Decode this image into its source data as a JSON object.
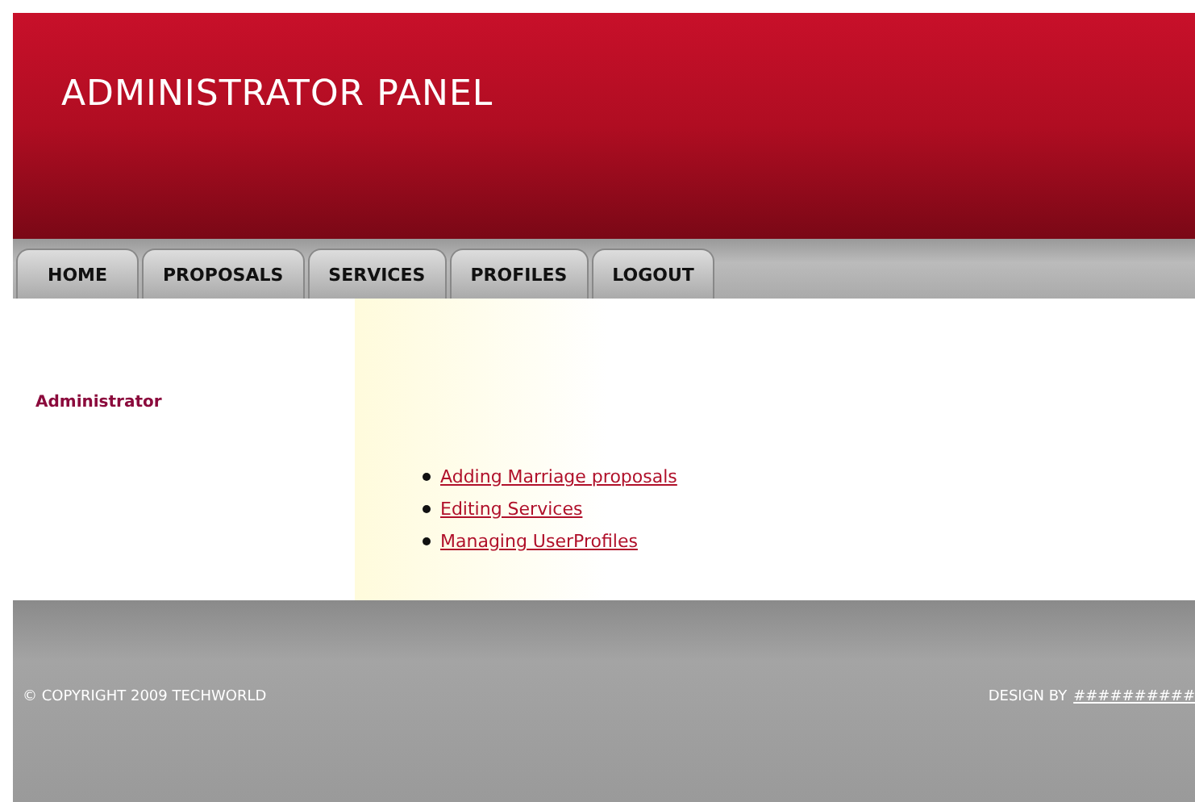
{
  "header": {
    "title": "ADMINISTRATOR PANEL"
  },
  "nav": {
    "tabs": [
      "HOME",
      "PROPOSALS",
      "SERVICES",
      "PROFILES",
      "LOGOUT"
    ]
  },
  "sidebar": {
    "heading": "Administrator"
  },
  "links": [
    "Adding Marriage proposals",
    "Editing Services",
    "Managing UserProfiles"
  ],
  "footer": {
    "copyright": "© COPYRIGHT 2009 TECHWORLD",
    "design_label": "DESIGN BY",
    "design_link": "##########"
  }
}
